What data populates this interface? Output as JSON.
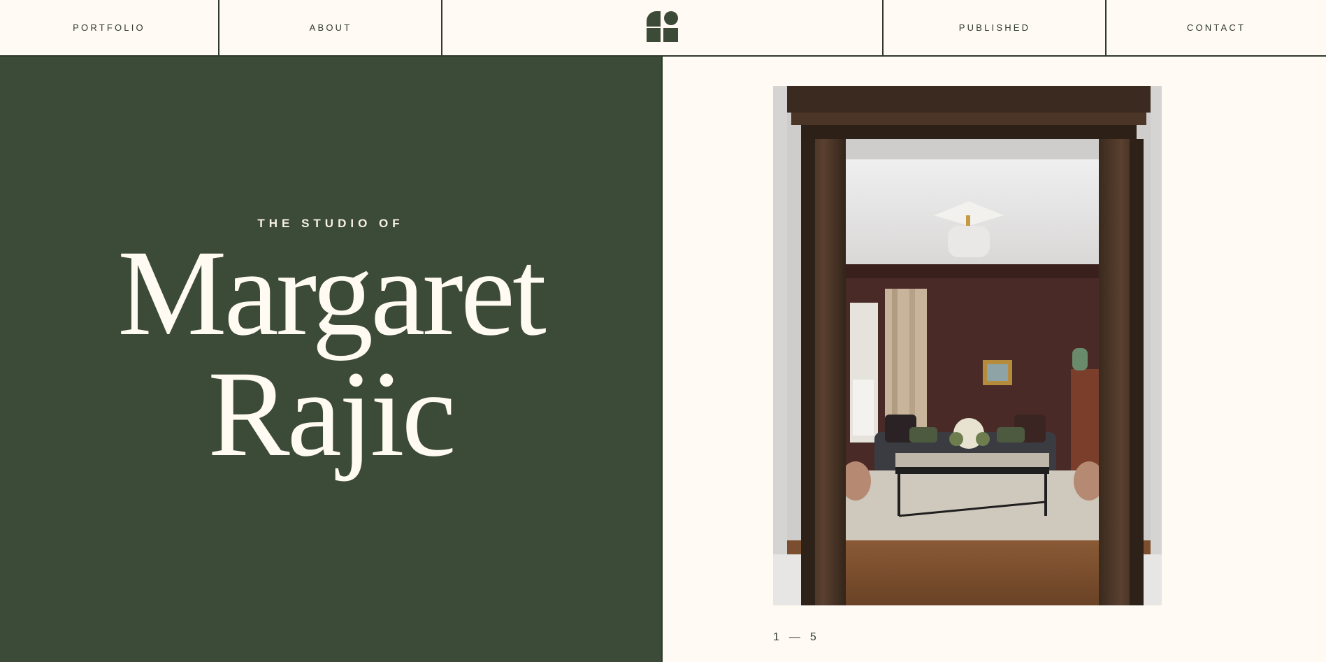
{
  "nav": {
    "items": [
      {
        "label": "PORTFOLIO"
      },
      {
        "label": "ABOUT"
      },
      {
        "label": "PUBLISHED"
      },
      {
        "label": "CONTACT"
      }
    ],
    "logo_icon": "studio-monogram-icon"
  },
  "hero": {
    "eyebrow": "THE STUDIO OF",
    "first_name": "Margaret",
    "last_name": "Rajic"
  },
  "slideshow": {
    "current": "1",
    "dash": "—",
    "total": "5"
  },
  "colors": {
    "green": "#3c4b37",
    "cream": "#fffaf4",
    "dark": "#2f3a2c"
  }
}
